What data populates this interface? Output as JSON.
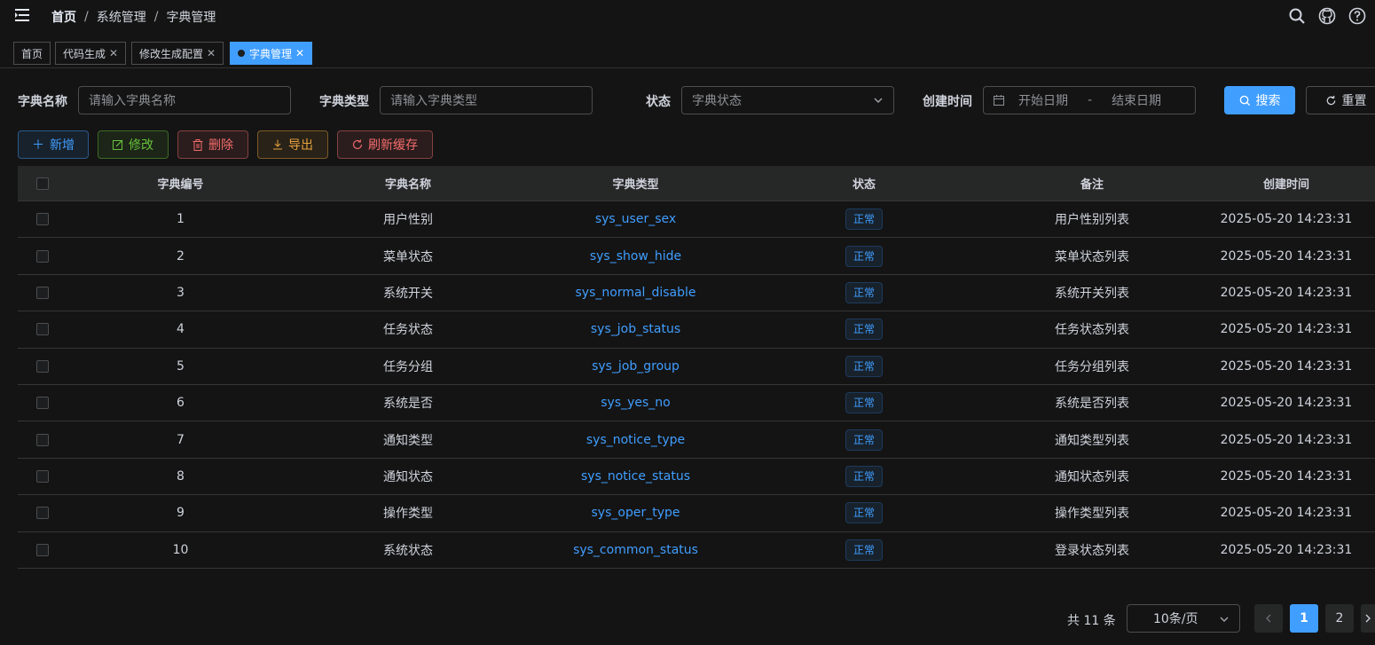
{
  "breadcrumb": {
    "home": "首页",
    "level1": "系统管理",
    "level2": "字典管理"
  },
  "nav_icons": [
    "search-icon",
    "github-icon",
    "question-icon"
  ],
  "tags": [
    {
      "label": "首页"
    },
    {
      "label": "代码生成"
    },
    {
      "label": "修改生成配置"
    },
    {
      "label": "字典管理"
    }
  ],
  "search": {
    "name_label": "字典名称",
    "name_placeholder": "请输入字典名称",
    "type_label": "字典类型",
    "type_placeholder": "请输入字典类型",
    "status_label": "状态",
    "status_placeholder": "字典状态",
    "time_label": "创建时间",
    "start_placeholder": "开始日期",
    "range_separator": "-",
    "end_placeholder": "结束日期",
    "search_btn": "搜索",
    "reset_btn": "重置"
  },
  "toolbar": {
    "add": "新增",
    "edit": "修改",
    "delete": "删除",
    "export": "导出",
    "refresh": "刷新缓存"
  },
  "table": {
    "headers": [
      "字典编号",
      "字典名称",
      "字典类型",
      "状态",
      "备注",
      "创建时间"
    ],
    "rows": [
      {
        "id": "1",
        "name": "用户性别",
        "type": "sys_user_sex",
        "status": "正常",
        "remark": "用户性别列表",
        "time": "2025-05-20 14:23:31"
      },
      {
        "id": "2",
        "name": "菜单状态",
        "type": "sys_show_hide",
        "status": "正常",
        "remark": "菜单状态列表",
        "time": "2025-05-20 14:23:31"
      },
      {
        "id": "3",
        "name": "系统开关",
        "type": "sys_normal_disable",
        "status": "正常",
        "remark": "系统开关列表",
        "time": "2025-05-20 14:23:31"
      },
      {
        "id": "4",
        "name": "任务状态",
        "type": "sys_job_status",
        "status": "正常",
        "remark": "任务状态列表",
        "time": "2025-05-20 14:23:31"
      },
      {
        "id": "5",
        "name": "任务分组",
        "type": "sys_job_group",
        "status": "正常",
        "remark": "任务分组列表",
        "time": "2025-05-20 14:23:31"
      },
      {
        "id": "6",
        "name": "系统是否",
        "type": "sys_yes_no",
        "status": "正常",
        "remark": "系统是否列表",
        "time": "2025-05-20 14:23:31"
      },
      {
        "id": "7",
        "name": "通知类型",
        "type": "sys_notice_type",
        "status": "正常",
        "remark": "通知类型列表",
        "time": "2025-05-20 14:23:31"
      },
      {
        "id": "8",
        "name": "通知状态",
        "type": "sys_notice_status",
        "status": "正常",
        "remark": "通知状态列表",
        "time": "2025-05-20 14:23:31"
      },
      {
        "id": "9",
        "name": "操作类型",
        "type": "sys_oper_type",
        "status": "正常",
        "remark": "操作类型列表",
        "time": "2025-05-20 14:23:31"
      },
      {
        "id": "10",
        "name": "系统状态",
        "type": "sys_common_status",
        "status": "正常",
        "remark": "登录状态列表",
        "time": "2025-05-20 14:23:31"
      }
    ]
  },
  "pagination": {
    "total": "共 11 条",
    "page_size": "10条/页",
    "pages": [
      "1",
      "2"
    ],
    "current": "1"
  },
  "colors": {
    "primary": "#409eff",
    "success": "#67c23a",
    "danger": "#f56c6c",
    "warning": "#e6a23c",
    "background": "#141414"
  }
}
